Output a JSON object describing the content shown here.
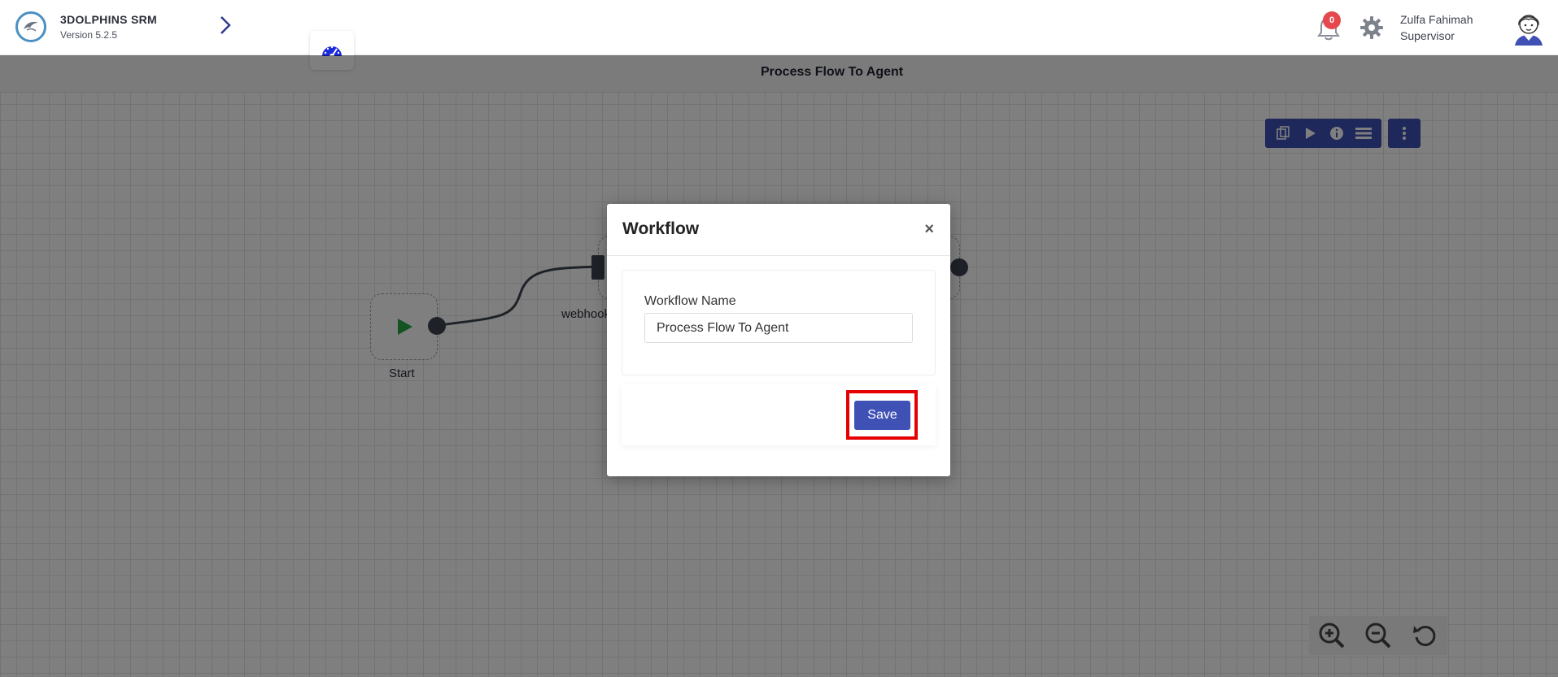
{
  "header": {
    "brand_name": "3DOLPHINS SRM",
    "version": "Version 5.2.5",
    "notifications_count": "0",
    "user_name": "Zulfa Fahimah",
    "user_role": "Supervisor"
  },
  "flow": {
    "title": "Process Flow To Agent"
  },
  "nodes": {
    "start_label": "Start",
    "webhook_label": "webhook"
  },
  "modal": {
    "title": "Workflow",
    "close_symbol": "×",
    "field_label": "Workflow Name",
    "field_value": "Process Flow To Agent",
    "save_label": "Save"
  },
  "colors": {
    "accent": "#3f51b5",
    "badge": "#e5484d",
    "highlight": "#e60000",
    "start_play": "#27a844"
  },
  "icons": {
    "toolbar": [
      "copy-icon",
      "play-icon",
      "info-icon",
      "list-icon"
    ],
    "more": "more-vertical-icon",
    "zoom": [
      "zoom-in-icon",
      "zoom-out-icon",
      "reset-icon"
    ]
  }
}
